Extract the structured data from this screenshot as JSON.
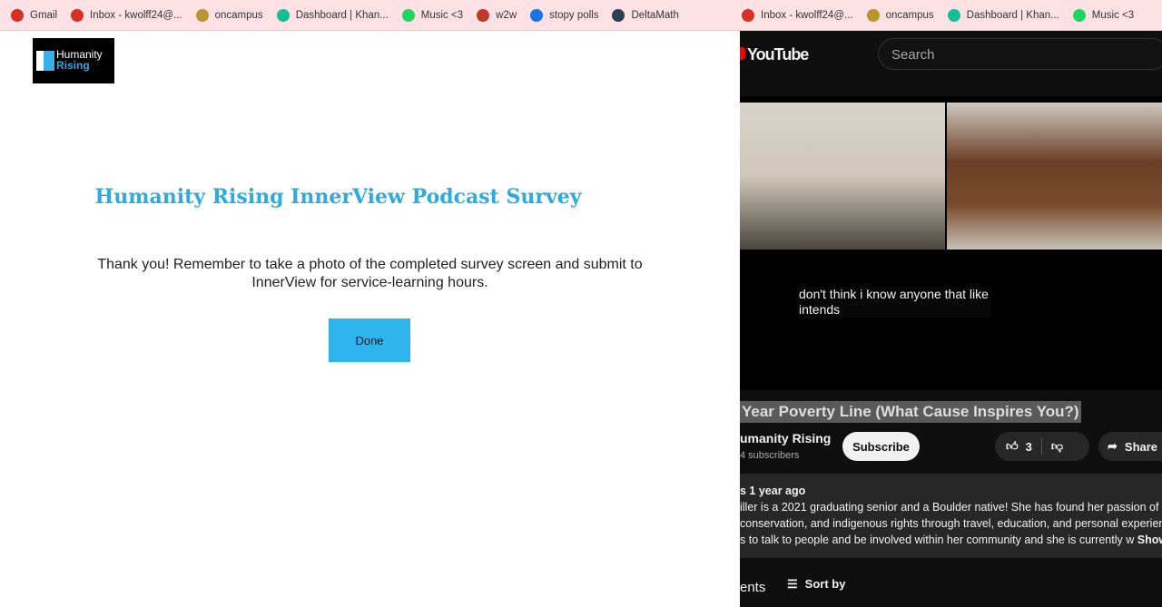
{
  "bookmarks_left": [
    {
      "label": "Gmail",
      "icon": "gmail-icon",
      "color": "#d93025"
    },
    {
      "label": "Inbox - kwolff24@...",
      "icon": "gmail-icon",
      "color": "#d93025"
    },
    {
      "label": "oncampus",
      "icon": "seal-icon",
      "color": "#b8962e"
    },
    {
      "label": "Dashboard | Khan...",
      "icon": "khan-academy-icon",
      "color": "#14bf96"
    },
    {
      "label": "Music <3",
      "icon": "spotify-icon",
      "color": "#1ed760"
    },
    {
      "label": "w2w",
      "icon": "w-icon",
      "color": "#c0392b"
    },
    {
      "label": "stopy polls",
      "icon": "polls-icon",
      "color": "#1a73e8"
    },
    {
      "label": "DeltaMath",
      "icon": "deltamath-icon",
      "color": "#2c3e50"
    }
  ],
  "bookmarks_right": [
    {
      "label": "Inbox - kwolff24@...",
      "icon": "gmail-icon",
      "color": "#d93025"
    },
    {
      "label": "oncampus",
      "icon": "seal-icon",
      "color": "#b8962e"
    },
    {
      "label": "Dashboard | Khan...",
      "icon": "khan-academy-icon",
      "color": "#14bf96"
    },
    {
      "label": "Music <3",
      "icon": "spotify-icon",
      "color": "#1ed760"
    }
  ],
  "survey": {
    "logo_line1": "Humanity",
    "logo_line2": "Rising",
    "title": "Humanity Rising InnerView Podcast Survey",
    "message": "Thank you! Remember to take a photo of the completed survey screen and submit to InnerView for service-learning hours.",
    "done_label": "Done",
    "accent": "#2eb5ee"
  },
  "youtube": {
    "logo": "YouTube",
    "search_placeholder": "Search",
    "caption_line1": "don't think i know anyone that like",
    "caption_line2": "intends",
    "video_title": "Year Poverty Line (What Cause Inspires You?)",
    "channel": "umanity Rising",
    "subscribers": "4 subscribers",
    "subscribe_label": "Subscribe",
    "likes": "3",
    "share_label": "Share",
    "desc_meta": "s  1 year ago",
    "desc_lines": [
      "iller is a 2021 graduating senior and a Boulder native! She has found her passion of",
      "conservation, and indigenous rights through travel, education, and personal experien",
      "s to talk to people and be involved within her community and she is currently w"
    ],
    "show_more": "Show",
    "comments_label": "ents",
    "sort_label": "Sort by"
  }
}
